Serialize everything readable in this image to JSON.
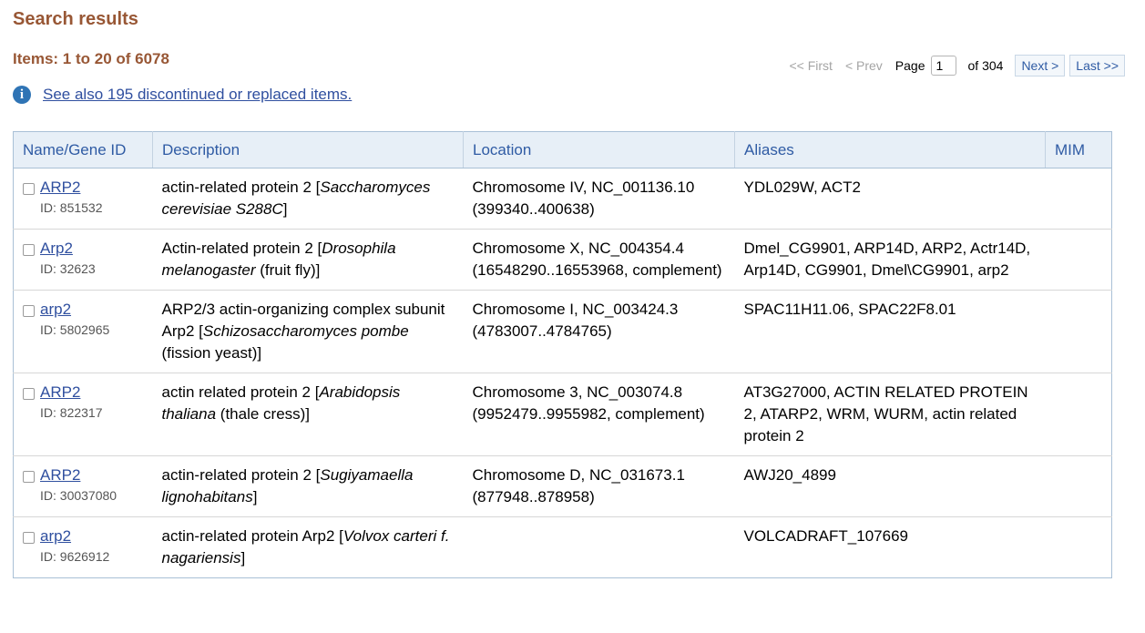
{
  "header": {
    "title": "Search results",
    "items_summary": "Items: 1 to 20 of 6078",
    "see_also": "See also 195 discontinued or replaced items."
  },
  "pager": {
    "first": "<< First",
    "prev": "< Prev",
    "page_label": "Page",
    "current_page": "1",
    "of_pages": "of 304",
    "next": "Next >",
    "last": "Last >>"
  },
  "table": {
    "headers": [
      "Name/Gene ID",
      "Description",
      "Location",
      "Aliases",
      "MIM"
    ],
    "rows": [
      {
        "name": "ARP2",
        "id": "ID: 851532",
        "desc_plain": "actin-related protein 2 [",
        "desc_italic": "Saccharomyces cerevisiae S288C",
        "desc_tail": "]",
        "location": "Chromosome IV, NC_001136.10 (399340..400638)",
        "aliases": "YDL029W, ACT2",
        "mim": ""
      },
      {
        "name": "Arp2",
        "id": "ID: 32623",
        "desc_plain": "Actin-related protein 2 [",
        "desc_italic": "Drosophila melanogaster",
        "desc_tail": " (fruit fly)]",
        "location": "Chromosome X, NC_004354.4 (16548290..16553968, complement)",
        "aliases": "Dmel_CG9901, ARP14D, ARP2, Actr14D, Arp14D, CG9901, Dmel\\CG9901, arp2",
        "mim": ""
      },
      {
        "name": "arp2",
        "id": "ID: 5802965",
        "desc_plain": "ARP2/3 actin-organizing complex subunit Arp2 [",
        "desc_italic": "Schizosaccharomyces pombe",
        "desc_tail": " (fission yeast)]",
        "location": "Chromosome I, NC_003424.3 (4783007..4784765)",
        "aliases": "SPAC11H11.06, SPAC22F8.01",
        "mim": ""
      },
      {
        "name": "ARP2",
        "id": "ID: 822317",
        "desc_plain": "actin related protein 2 [",
        "desc_italic": "Arabidopsis thaliana",
        "desc_tail": " (thale cress)]",
        "location": "Chromosome 3, NC_003074.8 (9952479..9955982, complement)",
        "aliases": "AT3G27000, ACTIN RELATED PROTEIN 2, ATARP2, WRM, WURM, actin related protein 2",
        "mim": ""
      },
      {
        "name": "ARP2",
        "id": "ID: 30037080",
        "desc_plain": "actin-related protein 2 [",
        "desc_italic": "Sugiyamaella lignohabitans",
        "desc_tail": "]",
        "location": "Chromosome D, NC_031673.1 (877948..878958)",
        "aliases": "AWJ20_4899",
        "mim": ""
      },
      {
        "name": "arp2",
        "id": "ID: 9626912",
        "desc_plain": "actin-related protein Arp2 [",
        "desc_italic": "Volvox carteri f. nagariensis",
        "desc_tail": "]",
        "location": "",
        "aliases": "VOLCADRAFT_107669",
        "mim": ""
      }
    ]
  }
}
